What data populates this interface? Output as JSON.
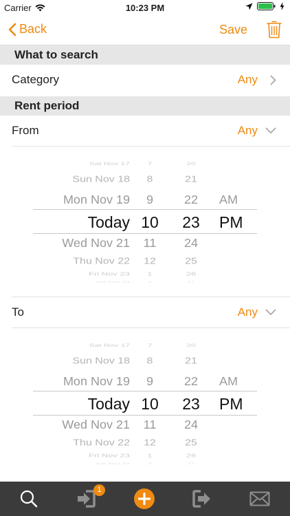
{
  "status_bar": {
    "carrier": "Carrier",
    "time": "10:23 PM"
  },
  "nav": {
    "back_label": "Back",
    "save_label": "Save"
  },
  "sections": {
    "what_to_search": "What to search",
    "rent_period": "Rent period"
  },
  "category": {
    "label": "Category",
    "value": "Any"
  },
  "from": {
    "label": "From",
    "value": "Any"
  },
  "to": {
    "label": "To",
    "value": "Any"
  },
  "picker_rows": [
    {
      "date": "Sat Nov 17",
      "hour": "7",
      "minute": "20",
      "ampm": ""
    },
    {
      "date": "Sun Nov 18",
      "hour": "8",
      "minute": "21",
      "ampm": ""
    },
    {
      "date": "Mon Nov 19",
      "hour": "9",
      "minute": "22",
      "ampm": "AM"
    },
    {
      "date": "Today",
      "hour": "10",
      "minute": "23",
      "ampm": "PM"
    },
    {
      "date": "Wed Nov 21",
      "hour": "11",
      "minute": "24",
      "ampm": ""
    },
    {
      "date": "Thu Nov 22",
      "hour": "12",
      "minute": "25",
      "ampm": ""
    },
    {
      "date": "Fri Nov 23",
      "hour": "1",
      "minute": "26",
      "ampm": ""
    },
    {
      "date": "Sat Nov 24",
      "hour": "2",
      "minute": "27",
      "ampm": ""
    }
  ],
  "tabs": {
    "inbox_badge": "1"
  },
  "colors": {
    "accent": "#ef8a12",
    "tab_bar": "#3b3b3b",
    "section_bg": "#e6e6e6"
  }
}
